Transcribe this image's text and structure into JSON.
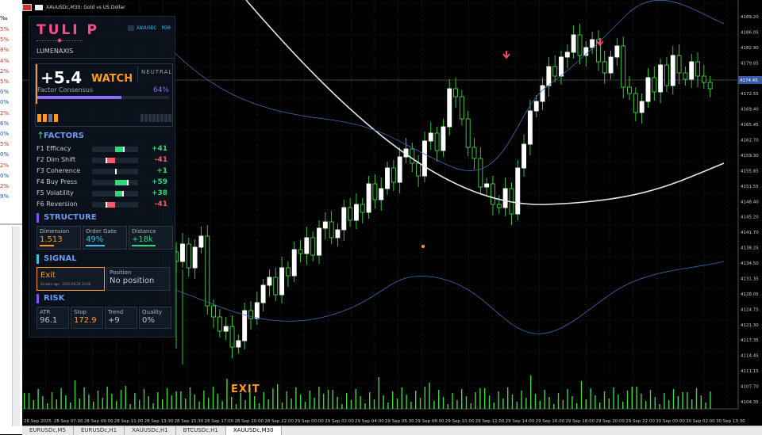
{
  "window": {
    "title": "XAUUSDc,M30:  Gold vs US Dollar"
  },
  "left_strip": {
    "header": "‰ ",
    "values": [
      {
        "text": "5%",
        "color": "#c0392b"
      },
      {
        "text": "5%",
        "color": "#c0392b"
      },
      {
        "text": "8%",
        "color": "#c0392b"
      },
      {
        "text": "4%",
        "color": "#c0392b"
      },
      {
        "text": "2%",
        "color": "#c0392b"
      },
      {
        "text": "5%",
        "color": "#c0392b"
      },
      {
        "text": "0%",
        "color": "#1f4fbf"
      },
      {
        "text": "0%",
        "color": "#1f4fbf"
      },
      {
        "text": "2%",
        "color": "#c0392b"
      },
      {
        "text": "6%",
        "color": "#1f4fbf"
      },
      {
        "text": "0%",
        "color": "#1f4fbf"
      },
      {
        "text": "5%",
        "color": "#c0392b"
      },
      {
        "text": "0%",
        "color": "#1f4fbf"
      },
      {
        "text": "2%",
        "color": "#c0392b"
      },
      {
        "text": "0%",
        "color": "#1f4fbf"
      },
      {
        "text": "2%",
        "color": "#c0392b"
      },
      {
        "text": "9%",
        "color": "#1f4fbf"
      }
    ]
  },
  "tabs": [
    {
      "label": "EURUSDc,M5",
      "active": false
    },
    {
      "label": "EURUSDc,H1",
      "active": false
    },
    {
      "label": "XAUUSDc,H1",
      "active": false
    },
    {
      "label": "BTCUSDc,H1",
      "active": false
    },
    {
      "label": "XAUUSDc,M30",
      "active": true
    }
  ],
  "price_axis": {
    "labels": [
      "4189.20",
      "4186.05",
      "4182.90",
      "4179.05",
      "4175.80",
      "4172.55",
      "4169.40",
      "4165.45",
      "4162.70",
      "4159.30",
      "4155.85",
      "4151.55",
      "4148.40",
      "4145.20",
      "4141.70",
      "4138.25",
      "4134.50",
      "4131.35",
      "4128.05",
      "4124.75",
      "4121.30",
      "4117.35",
      "4114.45",
      "4111.15",
      "4107.70",
      "4104.35"
    ],
    "current_price": "4174.45",
    "current_color": "#3a5aa8"
  },
  "time_axis": {
    "labels": [
      "26 Sep 2025",
      "28 Sep 07:00",
      "28 Sep 09:00",
      "28 Sep 11:00",
      "28 Sep 13:30",
      "28 Sep 15:30",
      "28 Sep 17:00",
      "28 Sep 20:00",
      "28 Sep 22:00",
      "29 Sep 00:00",
      "29 Sep 02:00",
      "29 Sep 04:00",
      "29 Sep 06:30",
      "29 Sep 08:00",
      "29 Sep 10:00",
      "29 Sep 12:00",
      "29 Sep 14:00",
      "29 Sep 16:00",
      "29 Sep 18:00",
      "29 Sep 20:00",
      "29 Sep 22:00",
      "30 Sep 00:00",
      "30 Sep 02:00",
      "30 Sep 13:30"
    ]
  },
  "chart_labels": {
    "exit": "EXIT"
  },
  "panel": {
    "brand": "TULI P",
    "symbol": "XAUUSDC",
    "timeframe": "M30",
    "subtitle": "LUMENAXIS",
    "score": "+5.4",
    "state": "WATCH",
    "bias": "NEUTRAL",
    "consensus_label": "Factor Consensus",
    "consensus_pct": "64%",
    "consensus_value": 0.64,
    "segments_lit": 4,
    "segments_total": 12,
    "factors_title": "FACTORS",
    "factors": [
      {
        "name": "F1 Efficacy",
        "value": "+41",
        "score": 41
      },
      {
        "name": "F2 Dim Shift",
        "value": "-41",
        "score": -41
      },
      {
        "name": "F3 Coherence",
        "value": "+1",
        "score": 1
      },
      {
        "name": "F4 Buy Press",
        "value": "+59",
        "score": 59
      },
      {
        "name": "F5 Volatility",
        "value": "+38",
        "score": 38
      },
      {
        "name": "F6 Reversion",
        "value": "-41",
        "score": -41
      }
    ],
    "structure_title": "STRUCTURE",
    "structure": [
      {
        "label": "Dimension",
        "value": "1.513",
        "color": "#ff9a1f"
      },
      {
        "label": "Order Gate",
        "value": "49%",
        "color": "#35c0e8"
      },
      {
        "label": "Distance",
        "value": "+18k",
        "color": "#35d67a"
      }
    ],
    "signal_title": "SIGNAL",
    "signal": {
      "action": "Exit",
      "action_meta": "62 bars ago · 2025.09.28 20:00",
      "position_label": "Position",
      "position_value": "No position"
    },
    "risk_title": "RISK",
    "risk": [
      {
        "label": "ATR",
        "value": "96.1",
        "color": "#b8c0c8"
      },
      {
        "label": "Stop",
        "value": "172.9",
        "color": "#ff9a1f"
      },
      {
        "label": "Trend",
        "value": "+9",
        "color": "#b8c0c8"
      },
      {
        "label": "Quality",
        "value": "0%",
        "color": "#b8c0c8"
      }
    ]
  },
  "colors": {
    "bull": "#ffffff",
    "bear": "#3fd63f",
    "wick": "#3fd63f",
    "ma": "#e6e6e6",
    "band": "#3a6fb5",
    "grid": "#3a3a3a",
    "accent": "#ff9a1f",
    "pink": "#ff4d8a",
    "purple": "#8a4dff"
  }
}
